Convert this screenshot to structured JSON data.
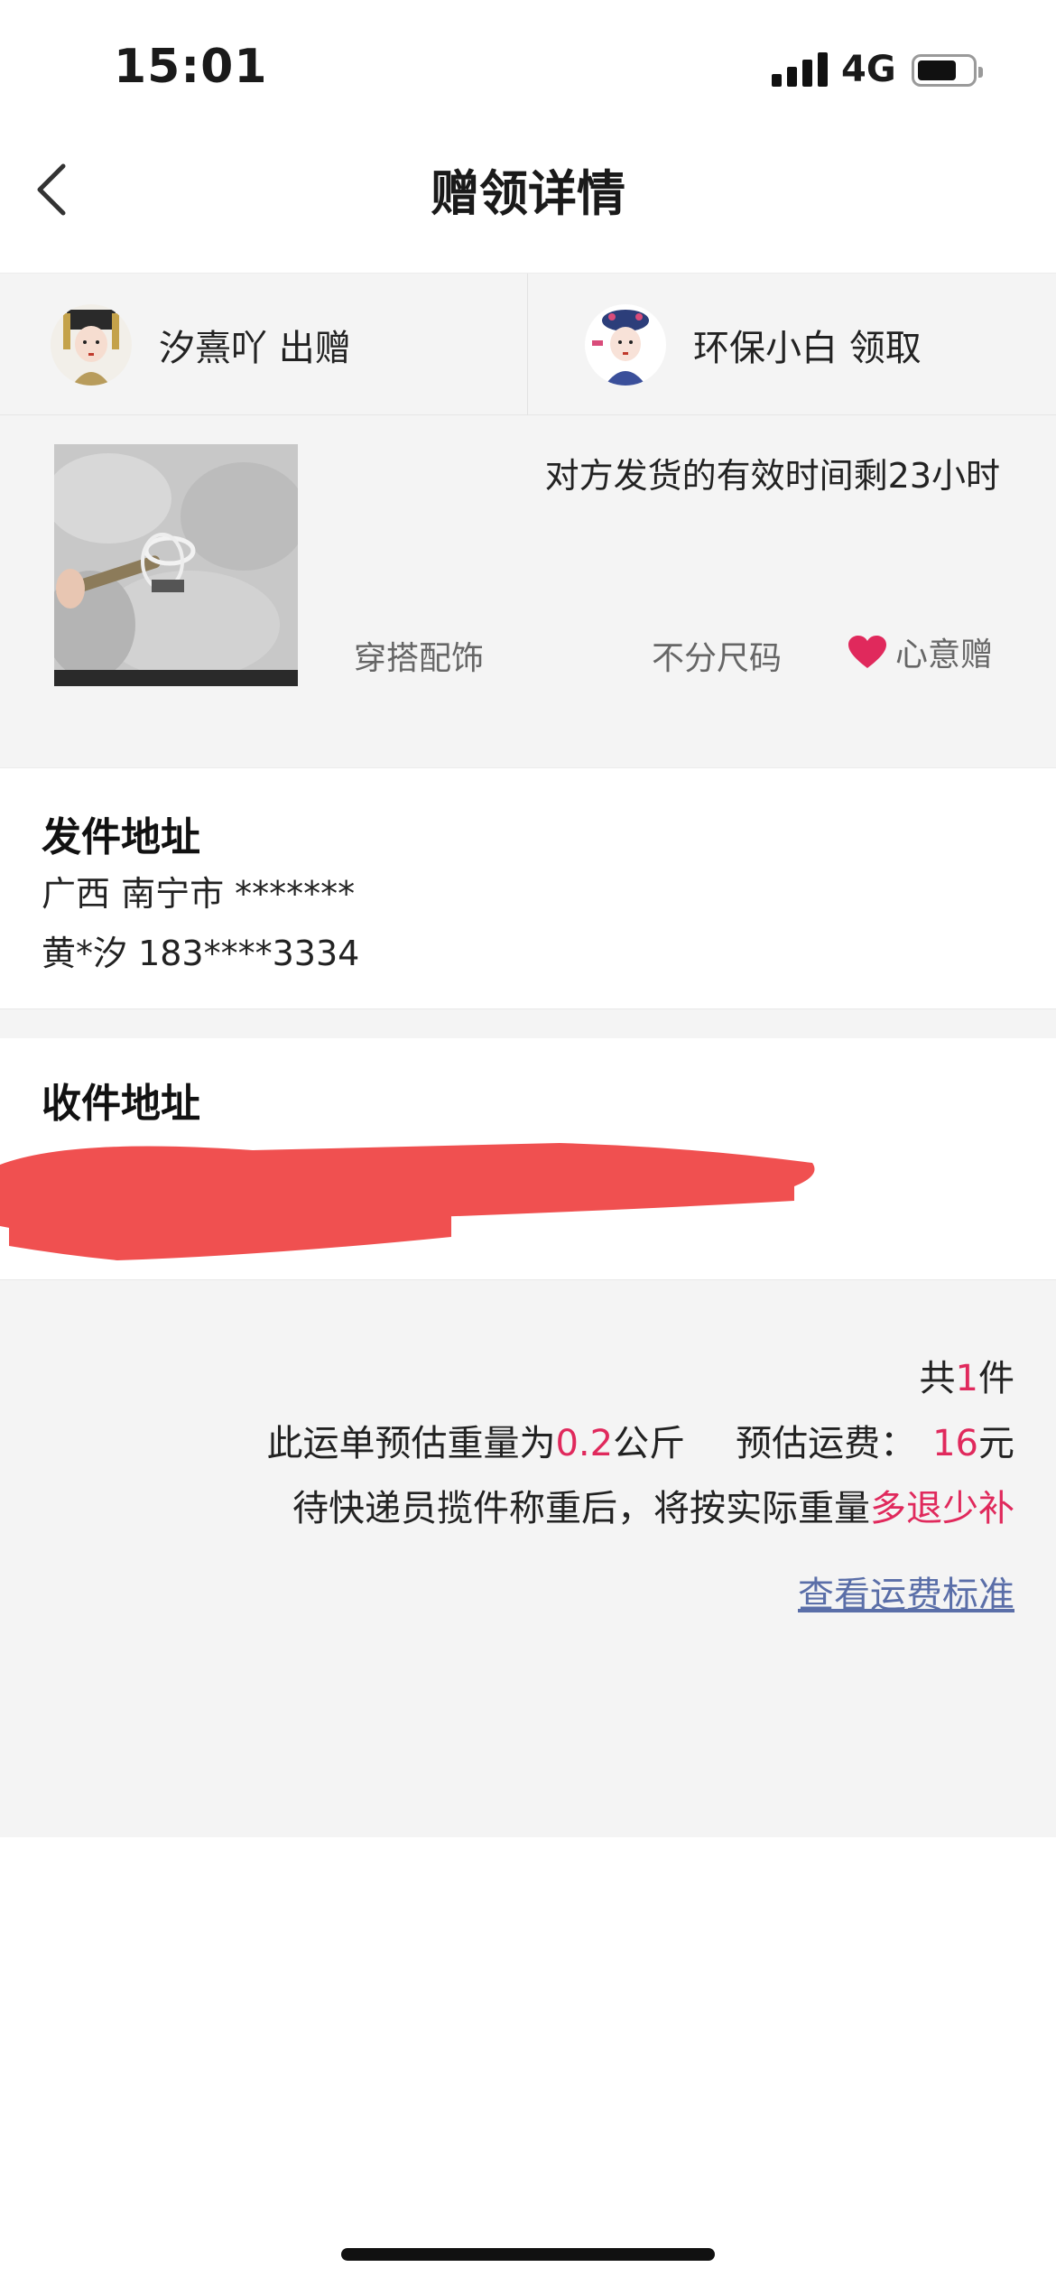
{
  "status_bar": {
    "time": "15:01",
    "network": "4G"
  },
  "nav": {
    "title": "赠领详情"
  },
  "giver": {
    "name": "汐熹吖",
    "role": "出赠"
  },
  "receiver_user": {
    "name": "环保小白",
    "role": "领取"
  },
  "item": {
    "deadline_text": "对方发货的有效时间剩23小时",
    "category": "穿搭配饰",
    "size": "不分尺码",
    "gift_type": "心意赠",
    "gift_type_icon": "heart-icon"
  },
  "sender_address": {
    "title": "发件地址",
    "region": "广西 南宁市 *******",
    "contact": "黄*汐 183****3334"
  },
  "receiver_address": {
    "title": "收件地址"
  },
  "shipping": {
    "count_prefix": "共",
    "count_value": "1",
    "count_suffix": "件",
    "weight_prefix": "此运单预估重量为",
    "weight_value": "0.2",
    "weight_unit": "公斤",
    "fee_label": "预估运费：",
    "fee_value": "16",
    "fee_unit": "元",
    "note_prefix": "待快递员揽件称重后，将按实际重量",
    "note_highlight": "多退少补",
    "fee_standard_link": "查看运费标准"
  },
  "colors": {
    "accent": "#e0295c",
    "link": "#5a6ea8",
    "redaction": "#f05050"
  }
}
